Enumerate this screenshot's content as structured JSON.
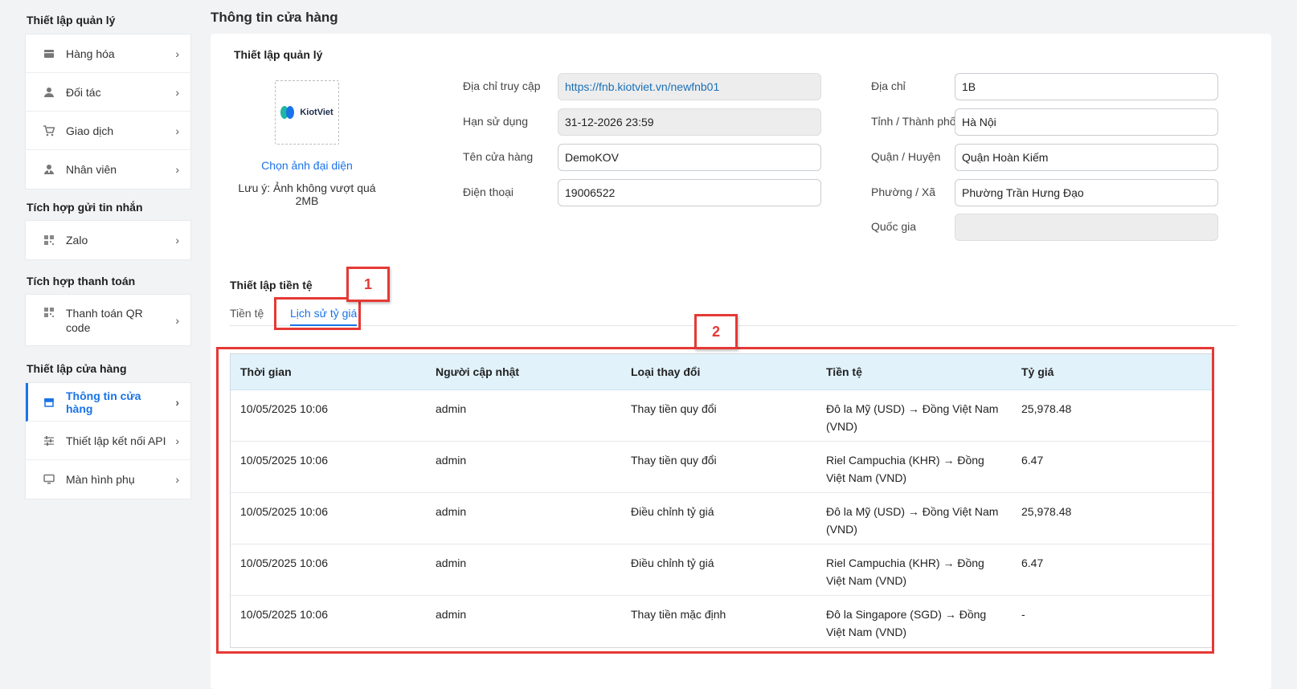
{
  "sidebar": {
    "sections": [
      {
        "title": "Thiết lập quản lý",
        "items": [
          {
            "label": "Hàng hóa",
            "icon": "box-icon"
          },
          {
            "label": "Đối tác",
            "icon": "user-icon"
          },
          {
            "label": "Giao dịch",
            "icon": "cart-icon"
          },
          {
            "label": "Nhân viên",
            "icon": "staff-icon"
          }
        ]
      },
      {
        "title": "Tích hợp gửi tin nhắn",
        "items": [
          {
            "label": "Zalo",
            "icon": "grid-icon"
          }
        ]
      },
      {
        "title": "Tích hợp thanh toán",
        "items": [
          {
            "label": "Thanh toán QR code",
            "icon": "grid-icon"
          }
        ]
      },
      {
        "title": "Thiết lập cửa hàng",
        "items": [
          {
            "label": "Thông tin cửa hàng",
            "icon": "store-icon",
            "active": true
          },
          {
            "label": "Thiết lập kết nối API",
            "icon": "sliders-icon"
          },
          {
            "label": "Màn hình phụ",
            "icon": "monitor-icon"
          }
        ]
      }
    ],
    "chevron": "›"
  },
  "page": {
    "title": "Thông tin cửa hàng",
    "section_title": "Thiết lập quản lý",
    "logo_text": "KiotViet",
    "choose_avatar": "Chọn ảnh đại diện",
    "avatar_note": "Lưu ý: Ảnh không vượt quá 2MB"
  },
  "form": {
    "access_url_label": "Địa chỉ truy cập",
    "access_url": "https://fnb.kiotviet.vn/newfnb01",
    "expiry_label": "Hạn sử dụng",
    "expiry": "31-12-2026 23:59",
    "store_name_label": "Tên cửa hàng",
    "store_name": "DemoKOV",
    "phone_label": "Điện thoại",
    "phone": "19006522",
    "address_label": "Địa chỉ",
    "address": "1B",
    "province_label": "Tỉnh / Thành phố",
    "province": "Hà Nội",
    "district_label": "Quận / Huyện",
    "district": "Quận Hoàn Kiếm",
    "ward_label": "Phường / Xã",
    "ward": "Phường Trần Hưng Đạo",
    "country_label": "Quốc gia",
    "country": ""
  },
  "currency": {
    "section_title": "Thiết lập tiền tệ",
    "tabs": [
      {
        "label": "Tiền tệ",
        "active": false
      },
      {
        "label": "Lịch sử tỷ giá",
        "active": true
      }
    ]
  },
  "history_table": {
    "headers": [
      "Thời gian",
      "Người cập nhật",
      "Loại thay đổi",
      "Tiền tệ",
      "Tỷ giá"
    ],
    "rows": [
      [
        "10/05/2025 10:06",
        "admin",
        "Thay tiền quy đổi",
        "Đô la Mỹ (USD) → Đồng Việt Nam (VND)",
        "25,978.48"
      ],
      [
        "10/05/2025 10:06",
        "admin",
        "Thay tiền quy đổi",
        "Riel Campuchia (KHR) → Đồng Việt Nam (VND)",
        "6.47"
      ],
      [
        "10/05/2025 10:06",
        "admin",
        "Điều chỉnh tỷ giá",
        "Đô la Mỹ (USD) → Đồng Việt Nam (VND)",
        "25,978.48"
      ],
      [
        "10/05/2025 10:06",
        "admin",
        "Điều chỉnh tỷ giá",
        "Riel Campuchia (KHR) → Đồng Việt Nam (VND)",
        "6.47"
      ],
      [
        "10/05/2025 10:06",
        "admin",
        "Thay tiền mặc định",
        "Đô la Singapore (SGD) → Đồng Việt Nam (VND)",
        "-"
      ]
    ]
  },
  "annotations": [
    "1",
    "2"
  ],
  "colors": {
    "accent": "#1a73e8",
    "annotation": "#e53935",
    "table_header": "#e1f2fb"
  }
}
